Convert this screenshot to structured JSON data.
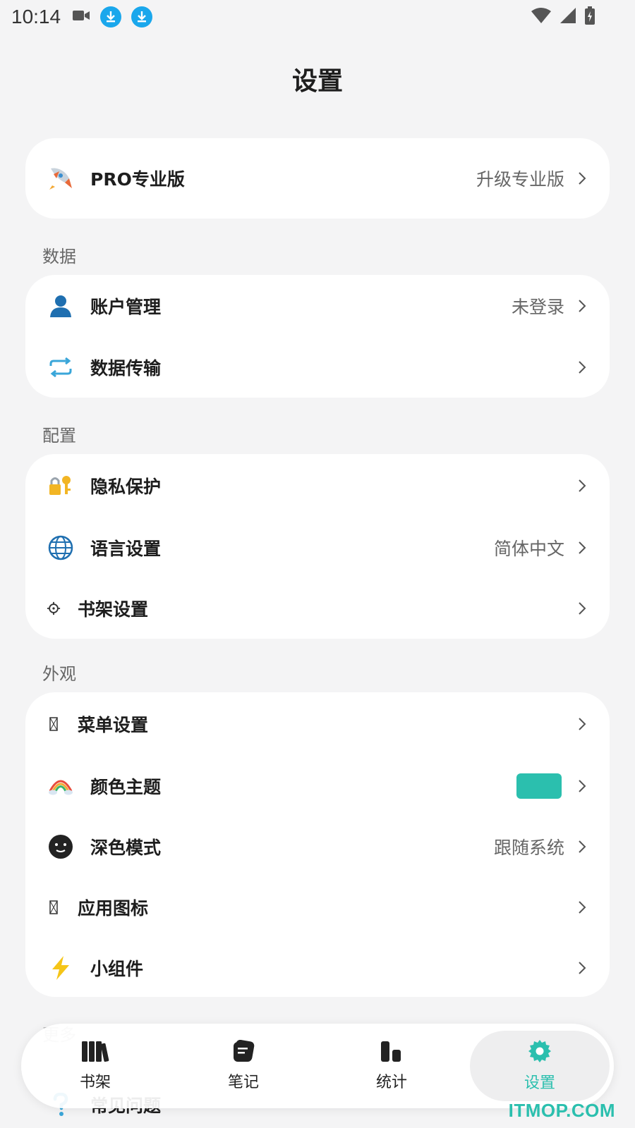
{
  "status_bar": {
    "time": "10:14"
  },
  "page": {
    "title": "设置"
  },
  "pro": {
    "label": "PRO专业版",
    "value": "升级专业版"
  },
  "sections": {
    "data": "数据",
    "config": "配置",
    "appearance": "外观",
    "more": "更多"
  },
  "data_items": [
    {
      "label": "账户管理",
      "value": "未登录",
      "icon": "user-icon"
    },
    {
      "label": "数据传输",
      "value": "",
      "icon": "transfer-icon"
    }
  ],
  "config_items": [
    {
      "label": "隐私保护",
      "value": "",
      "icon": "lock-key-icon"
    },
    {
      "label": "语言设置",
      "value": "简体中文",
      "icon": "globe-icon"
    },
    {
      "label": "书架设置",
      "value": "",
      "icon": "gear-icon"
    }
  ],
  "appearance_items": [
    {
      "label": "菜单设置",
      "value": "",
      "icon": "placeholder-icon"
    },
    {
      "label": "颜色主题",
      "value": "",
      "icon": "rainbow-icon",
      "swatch_color": "#2bbfae"
    },
    {
      "label": "深色模式",
      "value": "跟随系统",
      "icon": "dark-face-icon"
    },
    {
      "label": "应用图标",
      "value": "",
      "icon": "placeholder-icon"
    },
    {
      "label": "小组件",
      "value": "",
      "icon": "lightning-icon"
    }
  ],
  "more_items": [
    {
      "label": "常见问题",
      "icon": "question-icon"
    }
  ],
  "bottom_nav": [
    {
      "label": "书架",
      "icon": "books-icon"
    },
    {
      "label": "笔记",
      "icon": "note-icon"
    },
    {
      "label": "统计",
      "icon": "stats-icon"
    },
    {
      "label": "设置",
      "icon": "settings-icon",
      "active": true
    }
  ],
  "watermark": "ITMOP.COM",
  "colors": {
    "accent": "#2bbfae",
    "background": "#f4f4f5",
    "card": "#ffffff"
  }
}
